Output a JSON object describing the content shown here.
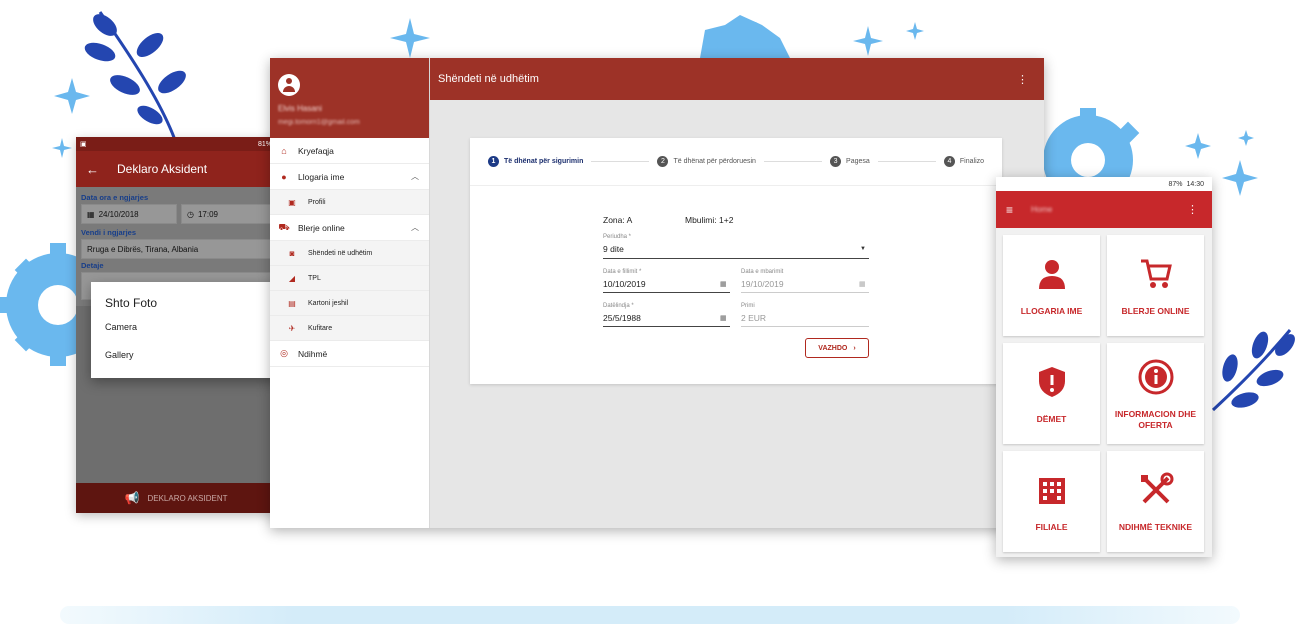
{
  "colors": {
    "brand_red": "#9d3227",
    "accent_blue": "#1c3a86",
    "deco_blue": "#6ab8ee",
    "deco_navy": "#2446b0"
  },
  "left_phone": {
    "status_text": "81%",
    "title": "Deklaro Aksident",
    "date_label": "Data ora e ngjarjes",
    "date_value": "24/10/2018",
    "time_value": "17:09",
    "place_label": "Vendi i ngjarjes",
    "place_value": "Rruga e Dibrës, Tirana, Albania",
    "details_label": "Detaje",
    "dialog_title": "Shto Foto",
    "dialog_options": [
      "Camera",
      "Gallery"
    ],
    "bottom_button": "DEKLARO AKSIDENT",
    "icons": {
      "back": "arrow-left-icon",
      "calendar": "calendar-icon",
      "clock": "clock-icon",
      "megaphone": "megaphone-icon"
    }
  },
  "main_window": {
    "user_name": "Elvis Hasani",
    "user_email": "megi.tomorri1@gmail.com",
    "title": "Shëndeti në udhëtim",
    "drawer": {
      "home": "Kryefaqja",
      "account": "Llogaria ime",
      "profile": "Profili",
      "buy": "Blerje online",
      "sub_items": [
        "Shëndeti në udhëtim",
        "TPL",
        "Kartoni jeshil",
        "Kufitare"
      ],
      "help": "Ndihmë"
    },
    "steps": [
      {
        "num": "1",
        "label": "Të dhënat për sigurimin"
      },
      {
        "num": "2",
        "label": "Të dhënat për përdoruesin"
      },
      {
        "num": "3",
        "label": "Pagesa"
      },
      {
        "num": "4",
        "label": "Finalizo"
      }
    ],
    "form": {
      "zona": "Zona: A",
      "mbulimi": "Mbulimi: 1+2",
      "periudha_label": "Periudha *",
      "periudha_value": "9 dite",
      "start_label": "Data e fillimit *",
      "start_value": "10/10/2019",
      "end_label": "Data e mbarimit",
      "end_value": "19/10/2019",
      "birth_label": "Datëlindja *",
      "birth_value": "25/5/1988",
      "premium_label": "Primi",
      "premium_value": "2 EUR",
      "continue_button": "VAZHDO"
    }
  },
  "right_phone": {
    "status_text": "87%",
    "time": "14:30",
    "title": "Home",
    "tiles": [
      {
        "label": "LLOGARIA IME",
        "icon": "user-icon"
      },
      {
        "label": "BLERJE ONLINE",
        "icon": "cart-icon"
      },
      {
        "label": "DËMET",
        "icon": "shield-icon"
      },
      {
        "label": "INFORMACION DHE OFERTA",
        "icon": "info-icon"
      },
      {
        "label": "FILIALE",
        "icon": "building-icon"
      },
      {
        "label": "NDIHMË TEKNIKE",
        "icon": "tools-icon"
      }
    ]
  }
}
